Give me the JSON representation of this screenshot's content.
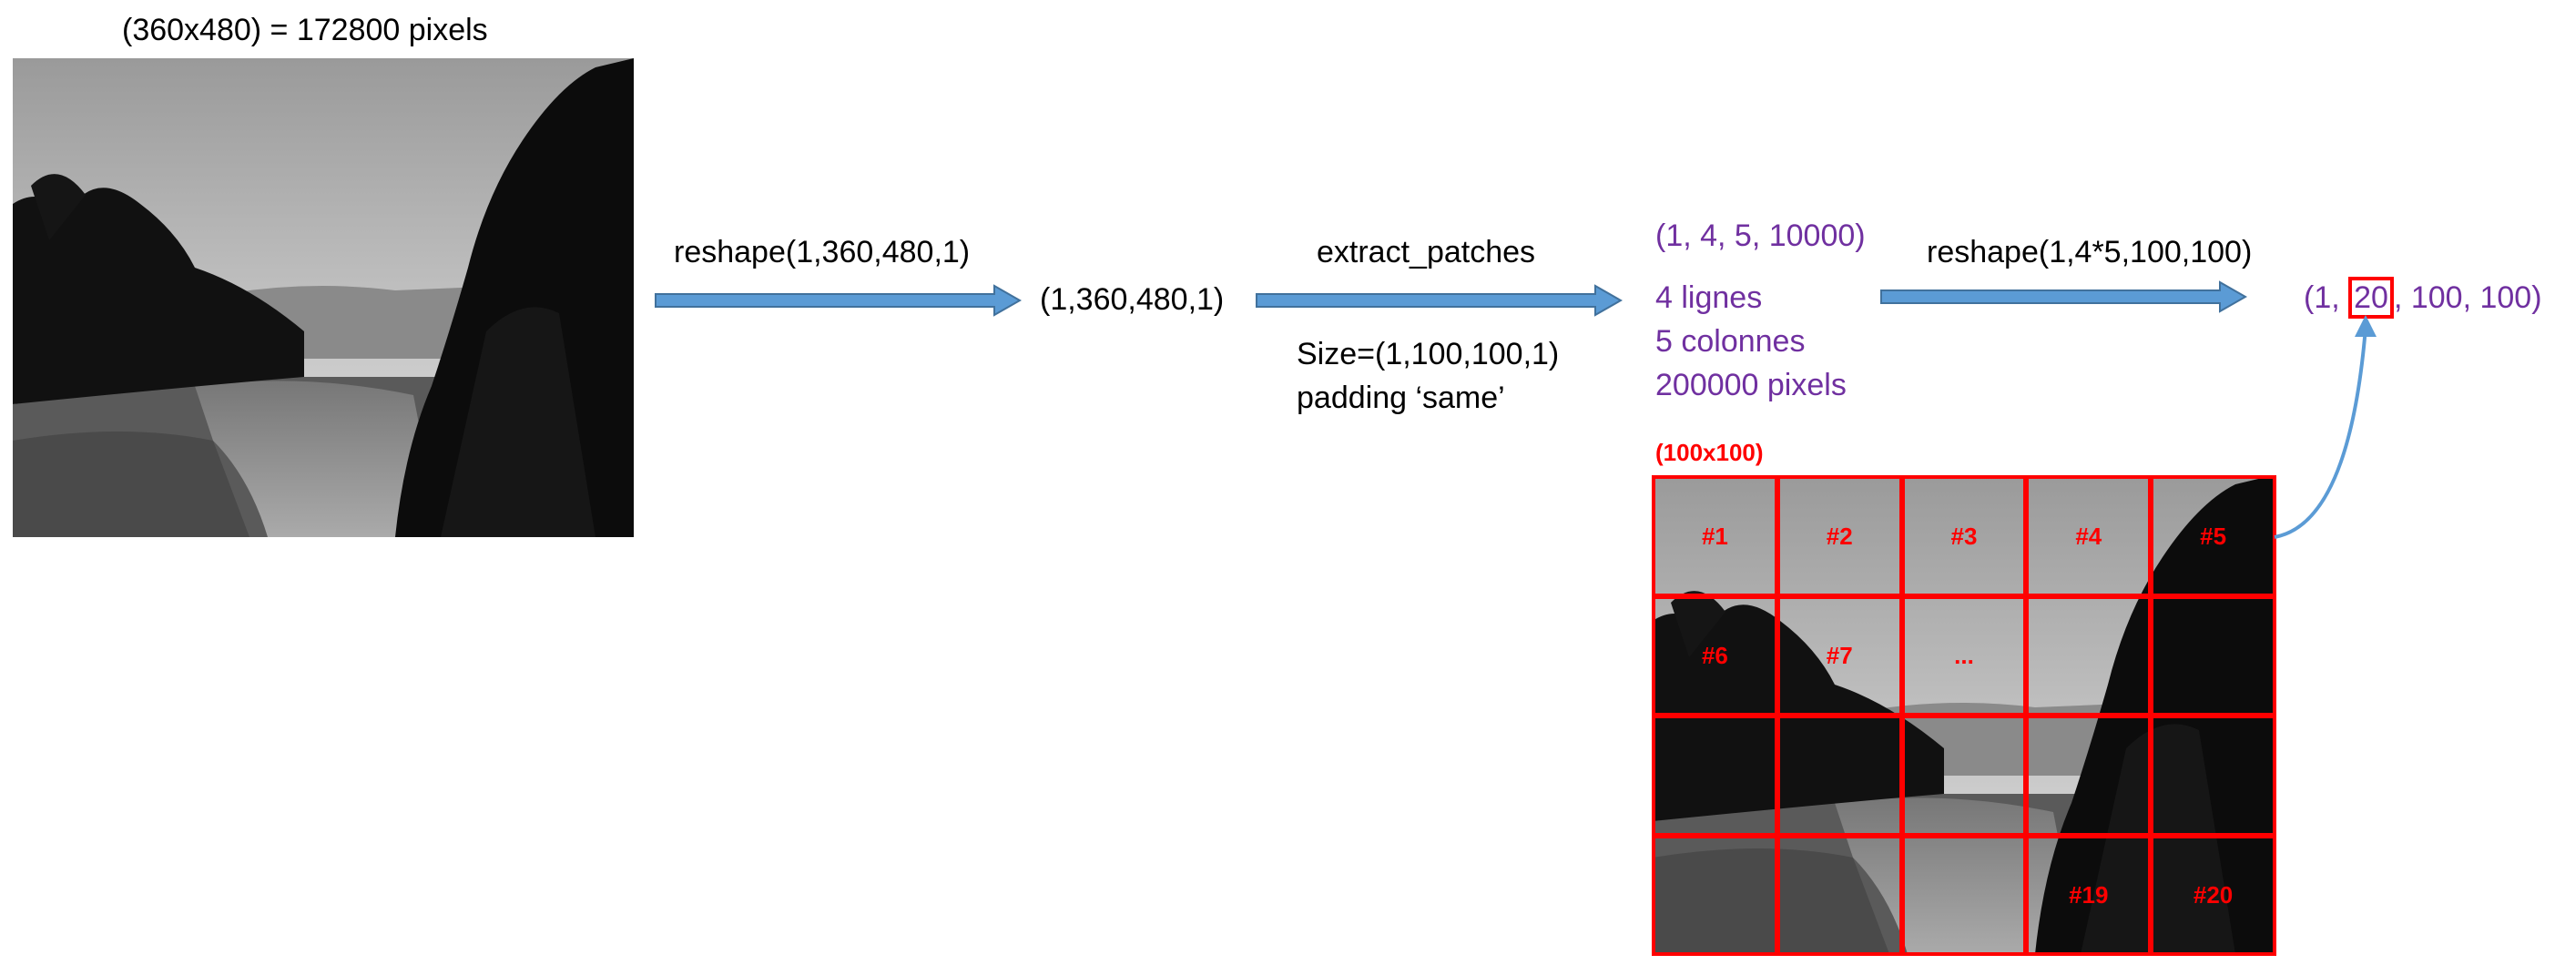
{
  "image_caption": "(360x480) = 172800 pixels",
  "step1": {
    "op": "reshape(1,360,480,1)",
    "result": "(1,360,480,1)"
  },
  "step2": {
    "op": "extract_patches",
    "size_param": "Size=(1,100,100,1)",
    "padding_param": "padding ‘same’",
    "result": "(1, 4, 5, 10000)",
    "details": [
      "4 lignes",
      "5 colonnes",
      "200000 pixels"
    ]
  },
  "step3": {
    "op": "reshape(1,4*5,100,100)",
    "result_prefix": "(1, ",
    "result_highlight": "20",
    "result_suffix": ", 100, 100)"
  },
  "patch_grid": {
    "patch_size": "(100x100)",
    "rows": 4,
    "cols": 5,
    "labels": [
      "#1",
      "#2",
      "#3",
      "#4",
      "#5",
      "#6",
      "#7",
      "...",
      "",
      "",
      "",
      "",
      "",
      "",
      "",
      "",
      "",
      "",
      "#19",
      "#20"
    ]
  },
  "colors": {
    "arrow_fill": "#5b9bd5",
    "arrow_stroke": "#41719c",
    "result_text": "#7030a0",
    "grid_red": "#ff0000",
    "curved_arrow": "#5b9bd5"
  }
}
